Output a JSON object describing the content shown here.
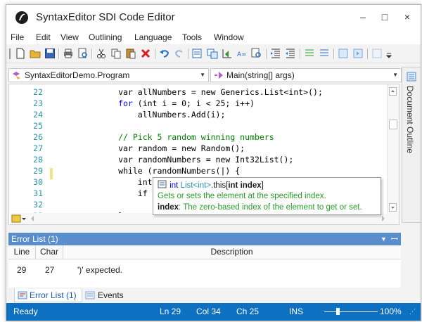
{
  "window": {
    "title": "SyntaxEditor SDI Code Editor",
    "minimize_glyph": "–",
    "maximize_glyph": "□",
    "close_glyph": "×"
  },
  "menu": [
    "File",
    "Edit",
    "View",
    "Outlining",
    "Language",
    "Tools",
    "Window"
  ],
  "toolbar_icons": [
    "new-file-icon",
    "open-folder-icon",
    "save-icon",
    "print-icon",
    "print-preview-icon",
    "cut-icon",
    "copy-icon",
    "paste-icon",
    "delete-icon",
    "undo-icon",
    "redo-icon",
    "find-icon",
    "replace-icon",
    "goto-icon",
    "case-icon",
    "find-next-icon",
    "indent-icon",
    "outdent-icon",
    "comment-icon",
    "uncomment-icon",
    "bookmark-icon",
    "bookmark-next-icon",
    "more-icon"
  ],
  "navbar": {
    "type_combo": "SyntaxEditorDemo.Program",
    "member_combo": "Main(string[] args)"
  },
  "code_lines": [
    {
      "num": "22",
      "parts": [
        {
          "t": "            var allNumbers = new Generics.List<int>();",
          "c": ""
        }
      ]
    },
    {
      "num": "23",
      "parts": [
        {
          "t": "            for ",
          "c": "kw"
        },
        {
          "t": "(int i = 0; i < 25; i++)",
          "c": ""
        }
      ]
    },
    {
      "num": "24",
      "parts": [
        {
          "t": "                allNumbers.Add(i);",
          "c": ""
        }
      ]
    },
    {
      "num": "25",
      "parts": [
        {
          "t": "",
          "c": ""
        }
      ]
    },
    {
      "num": "26",
      "parts": [
        {
          "t": "            // Pick 5 random winning numbers",
          "c": "cm"
        }
      ]
    },
    {
      "num": "27",
      "parts": [
        {
          "t": "            var random = new Random();",
          "c": ""
        }
      ]
    },
    {
      "num": "28",
      "parts": [
        {
          "t": "            var randomNumbers = new Int32List();",
          "c": ""
        }
      ]
    },
    {
      "num": "29",
      "parts": [
        {
          "t": "            while (randomNumbers(|) {",
          "c": ""
        }
      ]
    },
    {
      "num": "30",
      "parts": [
        {
          "t": "                int",
          "c": ""
        }
      ]
    },
    {
      "num": "31",
      "parts": [
        {
          "t": "                if",
          "c": ""
        }
      ]
    },
    {
      "num": "32",
      "parts": [
        {
          "t": "",
          "c": ""
        }
      ]
    },
    {
      "num": "33",
      "parts": [
        {
          "t": "            }",
          "c": ""
        }
      ]
    }
  ],
  "tooltip": {
    "signature_a": "int ",
    "signature_b": "List<int>",
    "signature_c": ".this[",
    "signature_d": "int index",
    "signature_e": "]",
    "summary": "Gets or sets the element at the specified index.",
    "param_name": "index",
    "param_desc": ": The zero-based index of the element to get or set."
  },
  "side_tab": "Document Outline",
  "error_panel": {
    "title": "Error List (1)",
    "columns": [
      "Line",
      "Char",
      "Description"
    ],
    "rows": [
      {
        "line": "29",
        "char": "27",
        "desc": "')' expected."
      }
    ]
  },
  "bottom_tabs": [
    "Error List (1)",
    "Events"
  ],
  "status": {
    "state": "Ready",
    "ln": "Ln 29",
    "col": "Col 34",
    "ch": "Ch 25",
    "mode": "INS",
    "zoom": "100%",
    "zoom_level": 0.25
  },
  "colors": {
    "accent": "#0e70c0",
    "panel_header": "#5a8dcc",
    "keyword": "#0000ff",
    "comment": "#008000",
    "line_number": "#2b91af"
  }
}
